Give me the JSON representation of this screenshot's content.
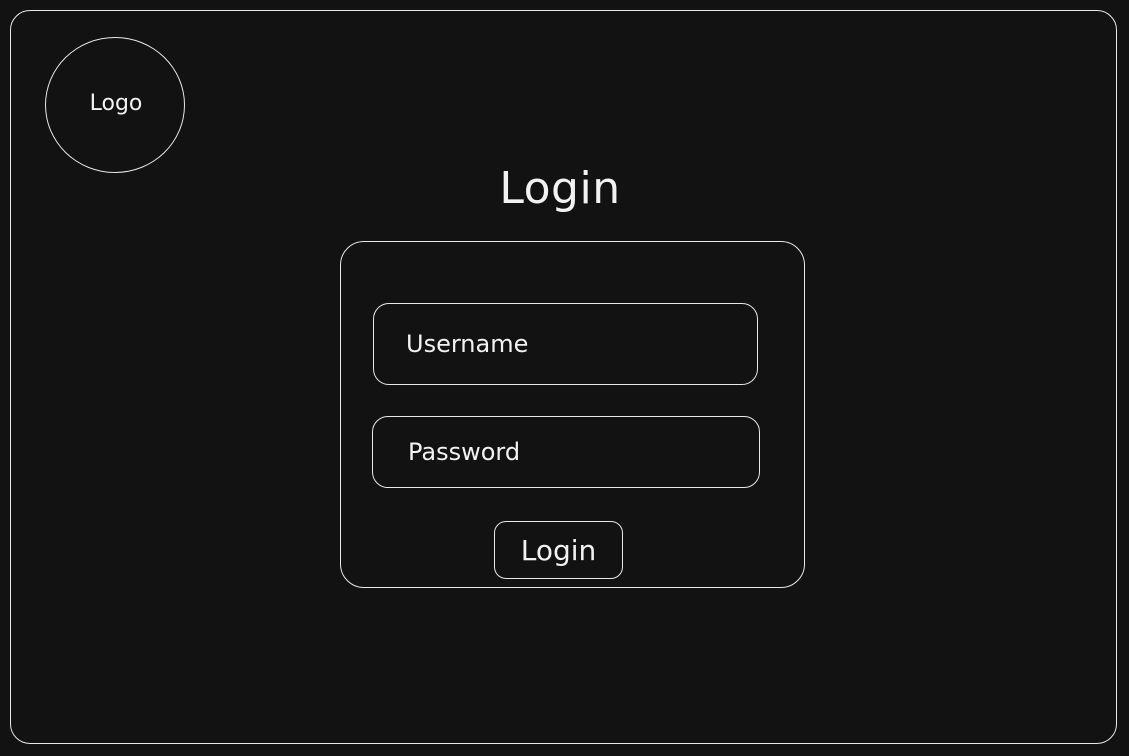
{
  "logo": {
    "label": "Logo"
  },
  "page": {
    "title": "Login"
  },
  "form": {
    "username": {
      "placeholder": "Username",
      "value": ""
    },
    "password": {
      "placeholder": "Password",
      "value": ""
    },
    "submit_label": "Login"
  },
  "colors": {
    "background": "#121212",
    "stroke": "#e8e8e8",
    "text": "#f2f2f2"
  }
}
